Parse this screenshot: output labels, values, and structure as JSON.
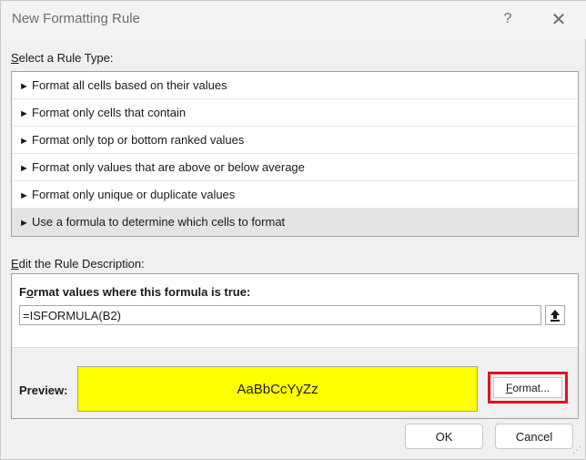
{
  "dialog": {
    "title": "New Formatting Rule",
    "help_label": "?",
    "close_label": "✕"
  },
  "rule_type": {
    "label_mnemonic": "S",
    "label_rest": "elect a Rule Type:",
    "arrow": "►",
    "items": [
      {
        "label": "Format all cells based on their values",
        "selected": false
      },
      {
        "label": "Format only cells that contain",
        "selected": false
      },
      {
        "label": "Format only top or bottom ranked values",
        "selected": false
      },
      {
        "label": "Format only values that are above or below average",
        "selected": false
      },
      {
        "label": "Format only unique or duplicate values",
        "selected": false
      },
      {
        "label": "Use a formula to determine which cells to format",
        "selected": true
      }
    ]
  },
  "rule_description": {
    "label_mnemonic": "E",
    "label_rest": "dit the Rule Description:",
    "formula_heading_mnemonic": "o",
    "formula_heading_pre": "F",
    "formula_heading_post": "rmat values where this formula is true:",
    "formula_value": "=ISFORMULA(B2)",
    "preview_label": "Preview:",
    "preview_text": "AaBbCcYyZz",
    "preview_fill": "#ffff00",
    "format_button_mnemonic": "F",
    "format_button_rest": "ormat...",
    "highlight_color": "#e0141e"
  },
  "buttons": {
    "ok": "OK",
    "cancel": "Cancel"
  }
}
